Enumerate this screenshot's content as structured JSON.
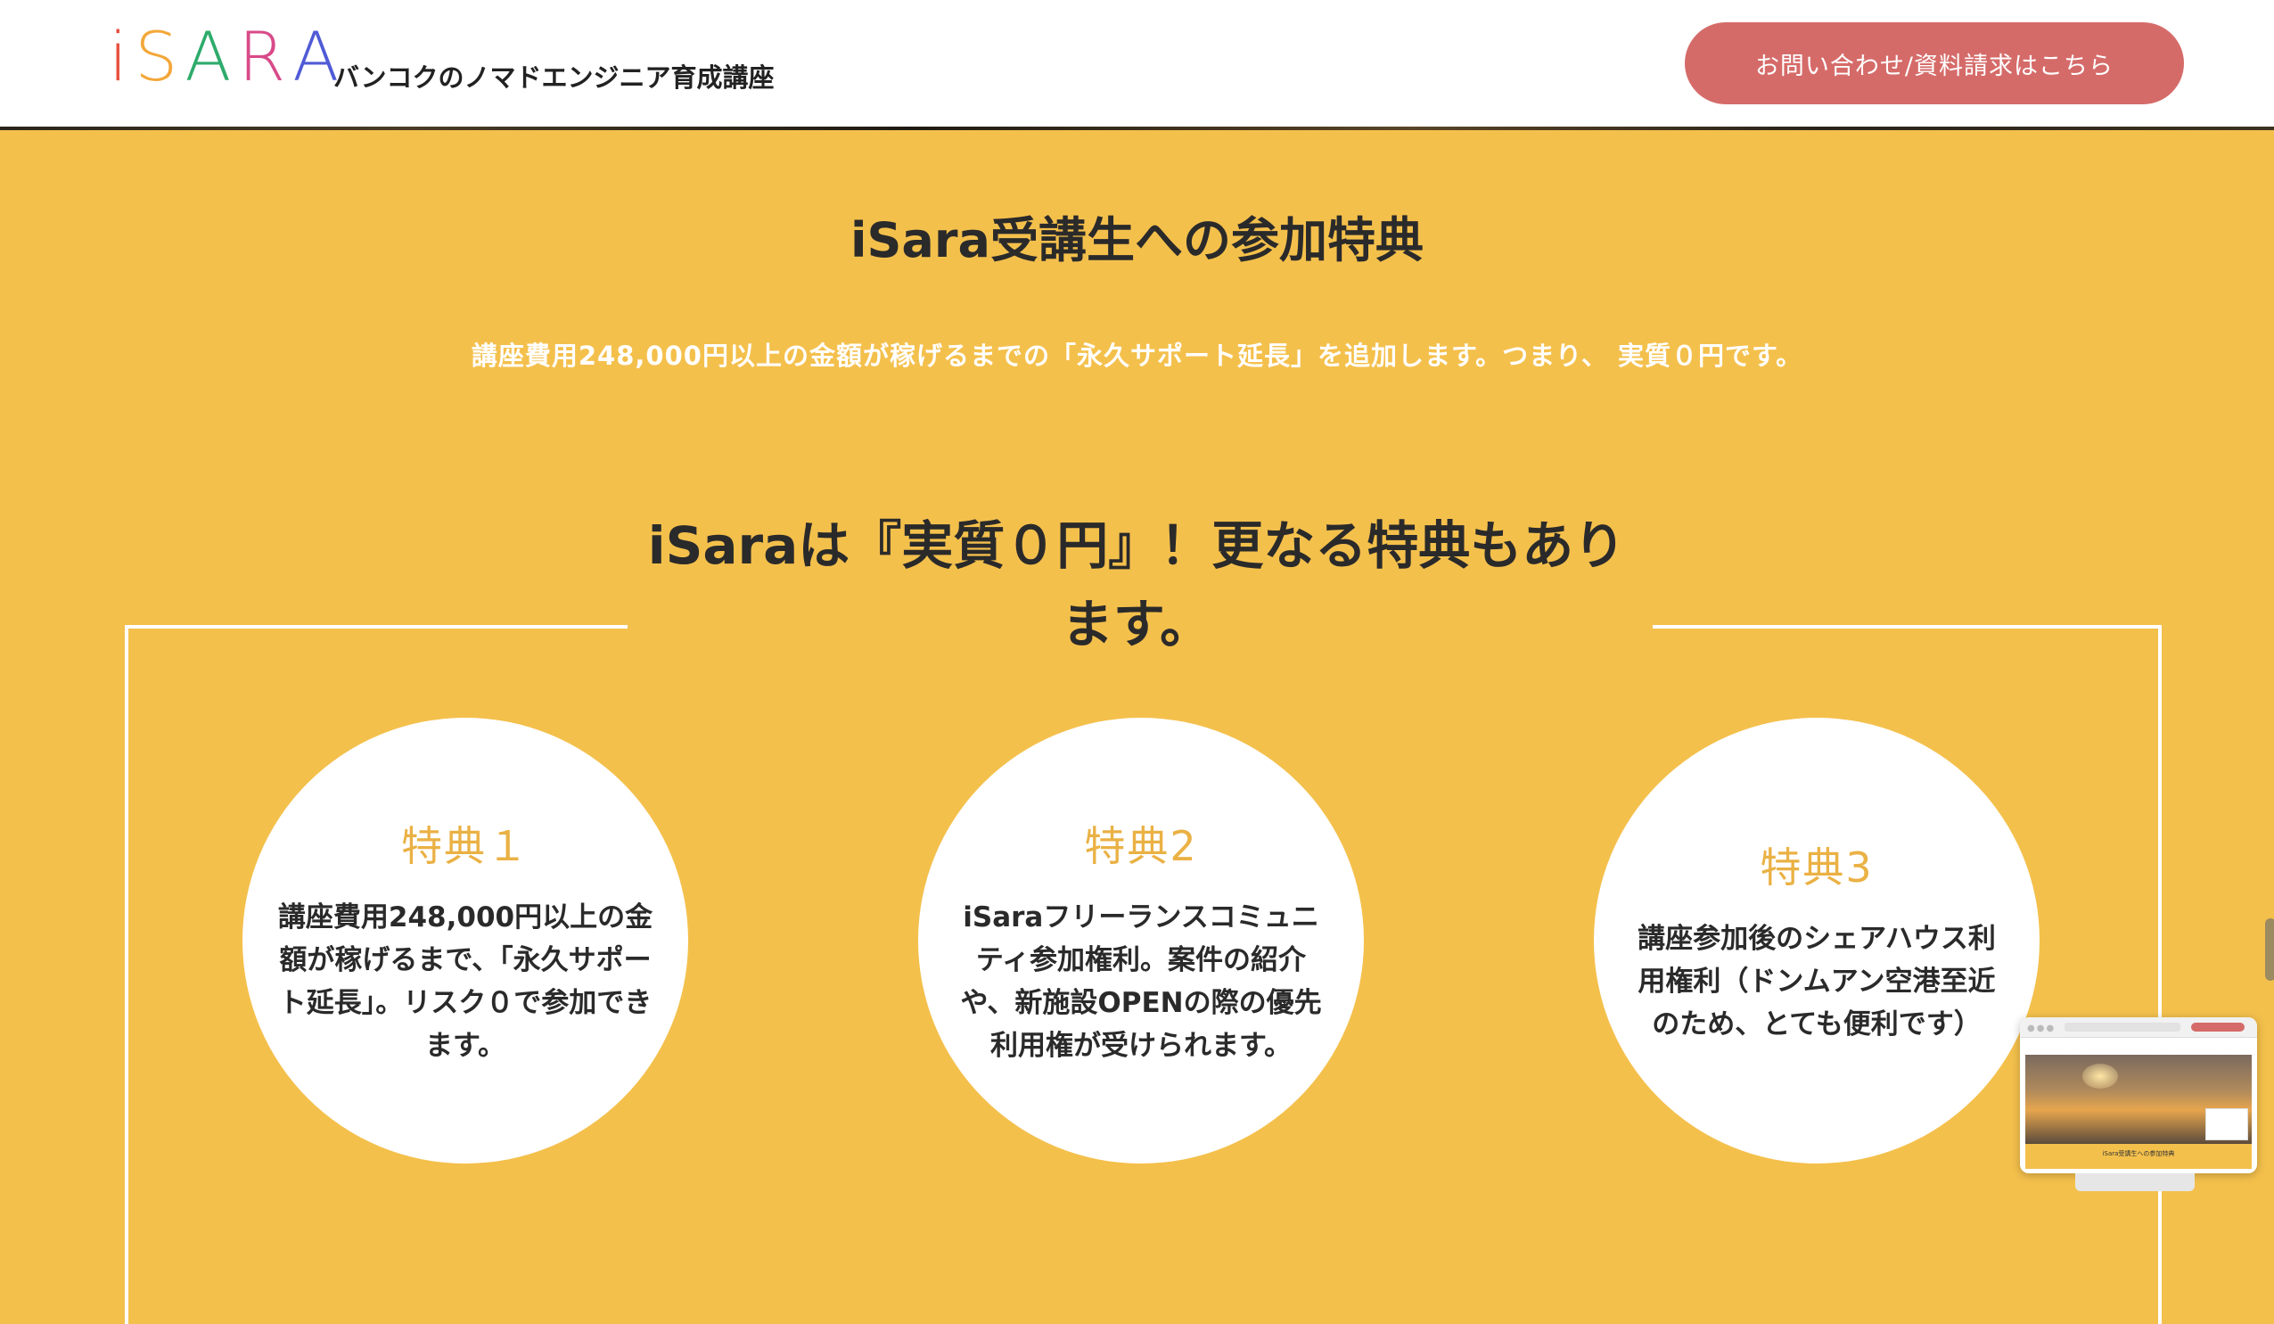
{
  "header": {
    "logo_letters": [
      {
        "char": "i",
        "color": "#e94f3f"
      },
      {
        "char": "S",
        "color": "#f3a73a"
      },
      {
        "char": "A",
        "color": "#2eab6b"
      },
      {
        "char": "R",
        "color": "#d84a8a"
      },
      {
        "char": "A",
        "color": "#4f5bd5"
      }
    ],
    "tagline": "バンコクのノマドエンジニア育成講座",
    "cta_label": "お問い合わせ/資料請求はこちら"
  },
  "section": {
    "title": "iSara受講生への参加特典",
    "lead": "講座費用248,000円以上の金額が稼げるまでの「永久サポート延長」を追加します。つまり、 実質０円です。",
    "bonus_heading": "iSaraは『実質０円』！更なる特典もあります。"
  },
  "benefits": [
    {
      "title": "特典１",
      "text": "講座費用248,000円以上の金額が稼げるまで、「永久サポート延長」。リスク０で参加できます。"
    },
    {
      "title": "特典2",
      "text": "iSaraフリーランスコミュニティ参加権利。案件の紹介や、新施設OPENの際の優先利用権が受けられます。"
    },
    {
      "title": "特典3",
      "text": "講座参加後のシェアハウス利用権利（ドンムアン空港至近のため、とても便利です）"
    }
  ],
  "preview": {
    "caption": "iSara受講生への参加特典"
  },
  "colors": {
    "background": "#f4c04c",
    "cta": "#d56b69",
    "benefit_title": "#eab144"
  }
}
